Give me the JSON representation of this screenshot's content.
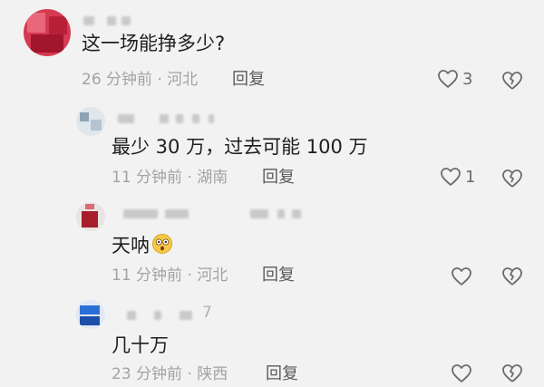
{
  "comments": [
    {
      "text": "这一场能挣多少?",
      "time": "26 分钟前",
      "separator": "·",
      "location": "河北",
      "reply_label": "回复",
      "likes": "3",
      "avatar_color": "#c2263e"
    },
    {
      "text": "最少 30 万，过去可能 100 万",
      "time": "11 分钟前",
      "separator": "·",
      "location": "湖南",
      "reply_label": "回复",
      "likes": "1",
      "avatar_color": "#9fb4c4"
    },
    {
      "text": "天呐",
      "emoji": "astonished-face",
      "time": "11 分钟前",
      "separator": "·",
      "location": "河北",
      "reply_label": "回复",
      "likes": "",
      "avatar_color": "#a51e2a"
    },
    {
      "text": "几十万",
      "time": "23 分钟前",
      "separator": "·",
      "location": "陕西",
      "reply_label": "回复",
      "likes": "",
      "name_suffix": "7",
      "avatar_color": "#2a6fd6"
    }
  ],
  "icons": {
    "like": "heart-outline-icon",
    "dislike": "broken-heart-outline-icon"
  }
}
